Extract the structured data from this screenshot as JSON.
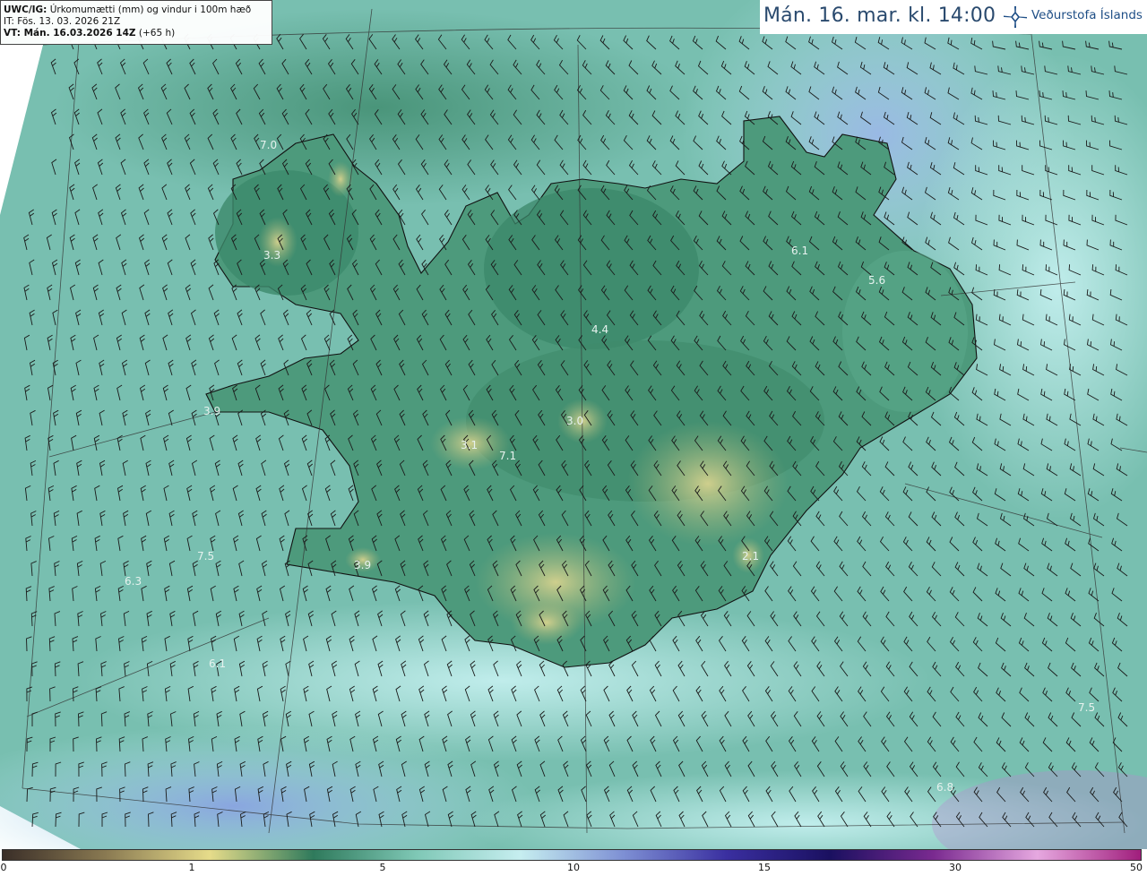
{
  "header": {
    "model_line": "UWC/IG: Úrkomumætti (mm) og vindur i 100m hæð",
    "model_code": "UWC/IG:",
    "model_desc": "Úrkomumætti (mm) og vindur i 100m hæð",
    "init_line": "IT: Fös. 13. 03. 2026 21Z",
    "valid_prefix": "VT: Mán. 16.03.2026 14Z",
    "valid_suffix": "(+65 h)"
  },
  "title": {
    "valid_time": "Mán. 16. mar. kl. 14:00",
    "brand": "Veðurstofa Íslands"
  },
  "colorbar": {
    "labels": [
      "0",
      "1",
      "5",
      "10",
      "15",
      "30",
      "50"
    ],
    "colors": [
      "#3a2e28",
      "#8a7a52",
      "#e6dc8a",
      "#2f7a5c",
      "#7fc8b6",
      "#c6eef0",
      "#7e90d4",
      "#3a2fa0",
      "#1a1060",
      "#7a2a90",
      "#e6a8e0",
      "#a01e7c"
    ]
  },
  "map_labels": [
    {
      "text": "7.0"
    },
    {
      "text": "3.3"
    },
    {
      "text": "6.1"
    },
    {
      "text": "5.6"
    },
    {
      "text": "4.4"
    },
    {
      "text": "3.9"
    },
    {
      "text": "3.0"
    },
    {
      "text": "3.1"
    },
    {
      "text": "7.1"
    },
    {
      "text": "7.5"
    },
    {
      "text": "6.3"
    },
    {
      "text": "3.9"
    },
    {
      "text": "2.1"
    },
    {
      "text": "6.1"
    },
    {
      "text": "7.5"
    },
    {
      "text": "6.8"
    }
  ],
  "colors": {
    "sea": "#7cc4b4",
    "land_green": "#3f8f72",
    "highland_yellow": "#c9c98a",
    "low_precip_blue": "#a9c6ec",
    "coastline": "#111111",
    "barbs": "#1a1a1a"
  }
}
